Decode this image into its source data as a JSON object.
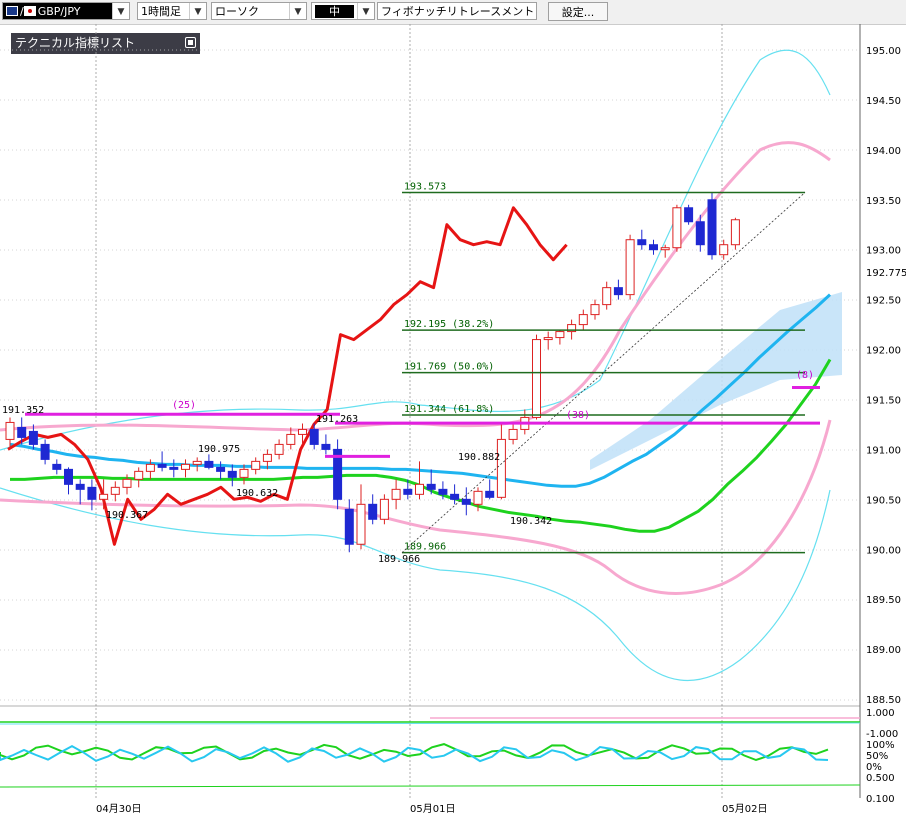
{
  "toolbar": {
    "pair": "GBP/JPY",
    "timeframe": "1時間足",
    "chart_style": "ローソク",
    "size": "中",
    "tool": "フィボナッチリトレースメント",
    "settings": "設定..."
  },
  "indicator_panel": {
    "title": "テクニカル指標リスト"
  },
  "chart_data": {
    "type": "candlestick",
    "instrument": "GBP/JPY",
    "timeframe": "1時間足",
    "y_axis": {
      "ylim": [
        188.4,
        195.2
      ],
      "ticks": [
        "195.00",
        "194.50",
        "194.00",
        "193.50",
        "193.00",
        "192.50",
        "192.00",
        "191.50",
        "191.00",
        "190.50",
        "190.00",
        "189.50",
        "189.00",
        "188.50"
      ],
      "current_price": "192.775"
    },
    "x_axis": {
      "labels": [
        "04月30日",
        "05月01日",
        "05月02日"
      ]
    },
    "grid": true,
    "candles": [
      {
        "o": 191.1,
        "h": 191.32,
        "l": 191.0,
        "c": 191.27
      },
      {
        "o": 191.22,
        "h": 191.32,
        "l": 191.05,
        "c": 191.12
      },
      {
        "o": 191.18,
        "h": 191.25,
        "l": 191.0,
        "c": 191.05
      },
      {
        "o": 191.05,
        "h": 191.1,
        "l": 190.85,
        "c": 190.9
      },
      {
        "o": 190.85,
        "h": 190.9,
        "l": 190.75,
        "c": 190.8
      },
      {
        "o": 190.8,
        "h": 190.82,
        "l": 190.55,
        "c": 190.65
      },
      {
        "o": 190.65,
        "h": 190.7,
        "l": 190.45,
        "c": 190.6
      },
      {
        "o": 190.62,
        "h": 190.7,
        "l": 190.39,
        "c": 190.5
      },
      {
        "o": 190.5,
        "h": 190.7,
        "l": 190.4,
        "c": 190.55
      },
      {
        "o": 190.55,
        "h": 190.68,
        "l": 190.48,
        "c": 190.62
      },
      {
        "o": 190.62,
        "h": 190.75,
        "l": 190.55,
        "c": 190.7
      },
      {
        "o": 190.7,
        "h": 190.82,
        "l": 190.62,
        "c": 190.78
      },
      {
        "o": 190.78,
        "h": 190.9,
        "l": 190.7,
        "c": 190.85
      },
      {
        "o": 190.85,
        "h": 190.98,
        "l": 190.78,
        "c": 190.82
      },
      {
        "o": 190.82,
        "h": 190.9,
        "l": 190.72,
        "c": 190.8
      },
      {
        "o": 190.8,
        "h": 190.9,
        "l": 190.72,
        "c": 190.85
      },
      {
        "o": 190.85,
        "h": 190.92,
        "l": 190.78,
        "c": 190.88
      },
      {
        "o": 190.88,
        "h": 190.95,
        "l": 190.8,
        "c": 190.82
      },
      {
        "o": 190.82,
        "h": 190.88,
        "l": 190.7,
        "c": 190.78
      },
      {
        "o": 190.78,
        "h": 190.85,
        "l": 190.63,
        "c": 190.72
      },
      {
        "o": 190.72,
        "h": 190.85,
        "l": 190.65,
        "c": 190.8
      },
      {
        "o": 190.8,
        "h": 190.92,
        "l": 190.75,
        "c": 190.88
      },
      {
        "o": 190.88,
        "h": 191.0,
        "l": 190.8,
        "c": 190.95
      },
      {
        "o": 190.95,
        "h": 191.1,
        "l": 190.9,
        "c": 191.05
      },
      {
        "o": 191.05,
        "h": 191.22,
        "l": 191.0,
        "c": 191.15
      },
      {
        "o": 191.15,
        "h": 191.26,
        "l": 191.05,
        "c": 191.2
      },
      {
        "o": 191.2,
        "h": 191.26,
        "l": 191.0,
        "c": 191.05
      },
      {
        "o": 191.05,
        "h": 191.15,
        "l": 190.95,
        "c": 191.0
      },
      {
        "o": 191.0,
        "h": 191.1,
        "l": 190.4,
        "c": 190.5
      },
      {
        "o": 190.4,
        "h": 190.5,
        "l": 189.97,
        "c": 190.05
      },
      {
        "o": 190.05,
        "h": 190.65,
        "l": 190.0,
        "c": 190.45
      },
      {
        "o": 190.45,
        "h": 190.55,
        "l": 190.25,
        "c": 190.3
      },
      {
        "o": 190.3,
        "h": 190.55,
        "l": 190.25,
        "c": 190.5
      },
      {
        "o": 190.5,
        "h": 190.7,
        "l": 190.4,
        "c": 190.6
      },
      {
        "o": 190.6,
        "h": 190.7,
        "l": 190.5,
        "c": 190.55
      },
      {
        "o": 190.55,
        "h": 190.88,
        "l": 190.5,
        "c": 190.65
      },
      {
        "o": 190.65,
        "h": 190.8,
        "l": 190.55,
        "c": 190.6
      },
      {
        "o": 190.6,
        "h": 190.68,
        "l": 190.5,
        "c": 190.55
      },
      {
        "o": 190.55,
        "h": 190.65,
        "l": 190.45,
        "c": 190.5
      },
      {
        "o": 190.5,
        "h": 190.62,
        "l": 190.34,
        "c": 190.45
      },
      {
        "o": 190.45,
        "h": 190.62,
        "l": 190.38,
        "c": 190.58
      },
      {
        "o": 190.58,
        "h": 190.7,
        "l": 190.5,
        "c": 190.52
      },
      {
        "o": 190.52,
        "h": 191.25,
        "l": 190.5,
        "c": 191.1
      },
      {
        "o": 191.1,
        "h": 191.25,
        "l": 191.05,
        "c": 191.2
      },
      {
        "o": 191.2,
        "h": 191.4,
        "l": 191.15,
        "c": 191.32
      },
      {
        "o": 191.32,
        "h": 192.15,
        "l": 191.3,
        "c": 192.1
      },
      {
        "o": 192.1,
        "h": 192.18,
        "l": 192.0,
        "c": 192.12
      },
      {
        "o": 192.12,
        "h": 192.2,
        "l": 192.05,
        "c": 192.18
      },
      {
        "o": 192.18,
        "h": 192.3,
        "l": 192.1,
        "c": 192.25
      },
      {
        "o": 192.25,
        "h": 192.4,
        "l": 192.2,
        "c": 192.35
      },
      {
        "o": 192.35,
        "h": 192.5,
        "l": 192.3,
        "c": 192.45
      },
      {
        "o": 192.45,
        "h": 192.68,
        "l": 192.4,
        "c": 192.62
      },
      {
        "o": 192.62,
        "h": 192.7,
        "l": 192.5,
        "c": 192.55
      },
      {
        "o": 192.55,
        "h": 193.15,
        "l": 192.5,
        "c": 193.1
      },
      {
        "o": 193.1,
        "h": 193.2,
        "l": 193.0,
        "c": 193.05
      },
      {
        "o": 193.05,
        "h": 193.1,
        "l": 192.95,
        "c": 193.0
      },
      {
        "o": 193.0,
        "h": 193.05,
        "l": 192.92,
        "c": 193.02
      },
      {
        "o": 193.02,
        "h": 193.45,
        "l": 192.98,
        "c": 193.42
      },
      {
        "o": 193.42,
        "h": 193.45,
        "l": 193.25,
        "c": 193.28
      },
      {
        "o": 193.28,
        "h": 193.35,
        "l": 192.98,
        "c": 193.05
      },
      {
        "o": 193.5,
        "h": 193.57,
        "l": 192.9,
        "c": 192.95
      },
      {
        "o": 192.95,
        "h": 193.1,
        "l": 192.9,
        "c": 193.05
      },
      {
        "o": 193.05,
        "h": 193.32,
        "l": 193.0,
        "c": 193.3
      }
    ],
    "series": [
      {
        "name": "ma_blue",
        "color": "#1fb4f0",
        "values": [
          191.05,
          191.03,
          191.0,
          190.98,
          190.95,
          190.93,
          190.92,
          190.9,
          190.89,
          190.87,
          190.86,
          190.85,
          190.85,
          190.84,
          190.84,
          190.84,
          190.83,
          190.83,
          190.82,
          190.82,
          190.82,
          190.81,
          190.81,
          190.81,
          190.81,
          190.81,
          190.81,
          190.8,
          190.8,
          190.79,
          190.78,
          190.77,
          190.76,
          190.74,
          190.72,
          190.7,
          190.68,
          190.66,
          190.64,
          190.63,
          190.63,
          190.66,
          190.72,
          190.8,
          190.88,
          190.95,
          191.05,
          191.15,
          191.27,
          191.4,
          191.52,
          191.65,
          191.78,
          191.92,
          192.05,
          192.18,
          192.3,
          192.42,
          192.55
        ]
      },
      {
        "name": "ma_green",
        "color": "#1ed21e",
        "values": [
          190.7,
          190.7,
          190.71,
          190.72,
          190.72,
          190.72,
          190.72,
          190.71,
          190.71,
          190.7,
          190.7,
          190.7,
          190.7,
          190.7,
          190.7,
          190.7,
          190.7,
          190.7,
          190.7,
          190.71,
          190.72,
          190.72,
          190.73,
          190.74,
          190.74,
          190.74,
          190.72,
          190.69,
          190.64,
          190.57,
          190.52,
          190.48,
          190.43,
          190.4,
          190.37,
          190.35,
          190.33,
          190.3,
          190.28,
          190.27,
          190.25,
          190.23,
          190.2,
          190.18,
          190.18,
          190.22,
          190.3,
          190.38,
          190.5,
          190.65,
          190.78,
          190.92,
          191.08,
          191.25,
          191.45,
          191.65,
          191.9
        ]
      },
      {
        "name": "price_line_red",
        "color": "#e61414",
        "values": [
          191.0,
          191.08,
          191.15,
          191.12,
          191.15,
          191.05,
          190.9,
          190.6,
          190.05,
          190.5,
          190.3,
          190.4,
          190.55,
          190.45,
          190.5,
          190.55,
          190.62,
          190.5,
          190.52,
          190.48,
          190.55,
          190.5,
          191.0,
          191.25,
          191.4,
          192.15,
          192.1,
          192.2,
          192.3,
          192.45,
          192.55,
          192.68,
          192.62,
          193.25,
          193.1,
          193.05,
          193.08,
          193.05,
          193.42,
          193.25,
          193.05,
          192.9,
          193.05
        ]
      }
    ],
    "fibonacci": [
      {
        "value": 193.573,
        "label": "193.573"
      },
      {
        "value": 192.195,
        "label": "192.195 (38.2%)"
      },
      {
        "value": 191.769,
        "label": "191.769 (50.0%)"
      },
      {
        "value": 191.344,
        "label": "191.344 (61.8%)"
      },
      {
        "value": 189.966,
        "label": "189.966"
      }
    ],
    "annotations": [
      {
        "text": "191.352",
        "kind": "high"
      },
      {
        "text": "(25)",
        "kind": "count"
      },
      {
        "text": "191.263",
        "kind": "high"
      },
      {
        "text": "190.975",
        "kind": "high"
      },
      {
        "text": "190.632",
        "kind": "low"
      },
      {
        "text": "190.367",
        "kind": "low"
      },
      {
        "text": "189.966",
        "kind": "low"
      },
      {
        "text": "190.882",
        "kind": "high"
      },
      {
        "text": "190.342",
        "kind": "low"
      },
      {
        "text": "(38)",
        "kind": "count"
      },
      {
        "text": "(8)",
        "kind": "count"
      }
    ],
    "sub_panels": [
      {
        "name": "osc1",
        "ticks": [
          "1.000",
          "-1.000"
        ]
      },
      {
        "name": "osc2",
        "ticks": [
          "100%",
          "50%",
          "0%"
        ]
      },
      {
        "name": "osc3",
        "ticks": [
          "0.500",
          "0.100"
        ]
      }
    ]
  }
}
